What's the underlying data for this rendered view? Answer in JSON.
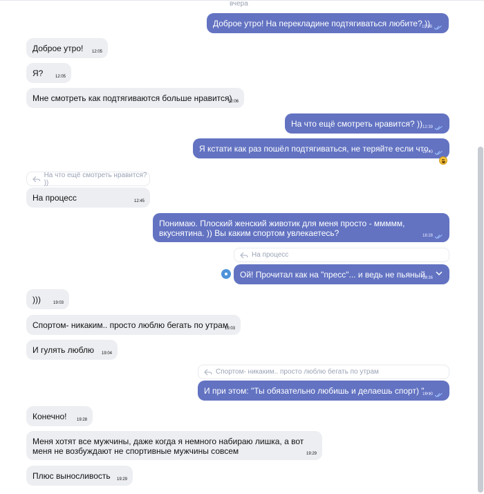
{
  "date_label": "вчера",
  "messages": [
    {
      "text": "Доброе утро! На перекладине подтягиваться любите? ))",
      "time": "10:08"
    },
    {
      "text": "Доброе утро!",
      "time": "12:05"
    },
    {
      "text": "Я?",
      "time": "12:05"
    },
    {
      "text": "Мне смотреть как подтягиваются больше нравится)",
      "time": "12:06"
    },
    {
      "text": "На что ещё смотреть нравится? ))",
      "time": "12:39"
    },
    {
      "text": "Я кстати как раз пошёл подтягиваться, не теряйте если что.",
      "time": "12:40"
    },
    {
      "text": "На процесс",
      "time": "12:45",
      "quote": "На что ещё смотреть нравится? ))"
    },
    {
      "text": "Понимаю. Плоский женский животик для меня просто - ммммм, вкуснятина. )) Вы каким спортом увлекаетесь?",
      "time": "18:28"
    },
    {
      "text": "Ой! Прочитал как на \"пресс\"... и ведь не пьяный.",
      "time": "18:36",
      "quote": "На процесс"
    },
    {
      "text": ")))",
      "time": "19:03"
    },
    {
      "text": "Спортом- никаким.. просто люблю бегать по утрам",
      "time": "19:03"
    },
    {
      "text": "И гулять люблю",
      "time": "19:04"
    },
    {
      "text": "И при этом: \"Ты обязательно любишь и делаешь спорт) \"...",
      "time": "19:10",
      "quote": "Спортом- никаким.. просто люблю бегать по утрам"
    },
    {
      "text": "Конечно!",
      "time": "19:28"
    },
    {
      "text": "Меня хотят все мужчины, даже когда я немного набираю лишка, а вот меня не возбуждают не спортивные мужчины совсем",
      "time": "19:29"
    },
    {
      "text": "Плюс выносливость",
      "time": "19:29"
    }
  ],
  "colors": {
    "outgoing": "#6373c2",
    "incoming": "#edeef2",
    "checks": "#9ec3ff"
  },
  "icons": {
    "read": "double-check-icon",
    "reply": "reply-arrow-icon",
    "reaction": "laughing-emoji-icon",
    "menu": "chevron-down-icon"
  }
}
